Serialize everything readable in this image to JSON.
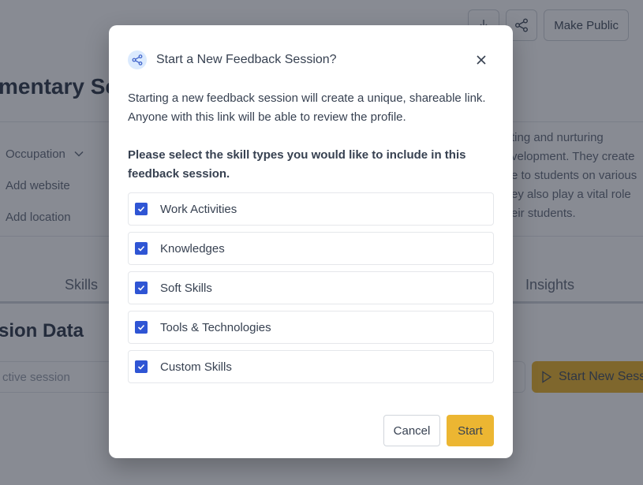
{
  "background": {
    "top_actions": {
      "download_icon": "download-icon",
      "share_icon": "share-icon",
      "make_public_label": "Make Public"
    },
    "profile_title": "mentary Sc",
    "meta": {
      "occupation_label": "Occupation",
      "website_label": "Add website",
      "location_label": "Add location"
    },
    "description_lines": [
      "ting and nurturing",
      "velopment. They create",
      "e to students on various",
      "ey also play a vital role",
      "eir students."
    ],
    "tabs": [
      "Skills",
      "Insights"
    ],
    "section_title": "sion Data",
    "session_input_placeholder": "ctive session",
    "start_new_session_label": "Start New Sessi"
  },
  "modal": {
    "icon": "share-icon",
    "title": "Start a New Feedback Session?",
    "close_icon": "close-icon",
    "description": "Starting a new feedback session will create a unique, shareable link. Anyone with this link will be able to review the profile.",
    "prompt": "Please select the skill types you would like to include in this feedback session.",
    "options": [
      {
        "label": "Work Activities",
        "checked": true
      },
      {
        "label": "Knowledges",
        "checked": true
      },
      {
        "label": "Soft Skills",
        "checked": true
      },
      {
        "label": "Tools & Technologies",
        "checked": true
      },
      {
        "label": "Custom Skills",
        "checked": true
      }
    ],
    "cancel_label": "Cancel",
    "start_label": "Start"
  },
  "colors": {
    "accent_yellow": "#ecb632",
    "checkbox_blue": "#2f55d4",
    "icon_bg": "#dbeafe"
  }
}
